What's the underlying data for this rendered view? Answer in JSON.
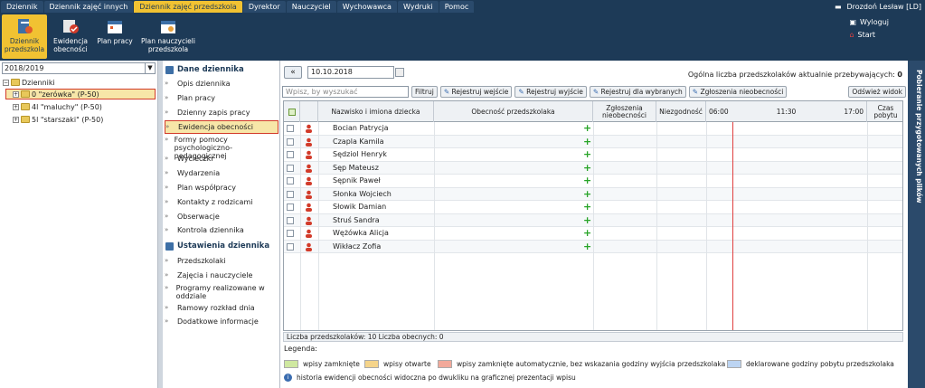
{
  "topnav": {
    "tabs": [
      "Dziennik",
      "Dziennik zajęć innych",
      "Dziennik zajęć przedszkola",
      "Dyrektor",
      "Nauczyciel",
      "Wychowawca",
      "Wydruki",
      "Pomoc"
    ],
    "active_tab": "Dziennik zajęć przedszkola",
    "user": "Drozdoń Lesław [LD]"
  },
  "toolbar": {
    "buttons": [
      {
        "label": "Dziennik przedszkola",
        "icon": "kindergarten-journal-icon"
      },
      {
        "label": "Ewidencja obecności",
        "icon": "attendance-icon"
      },
      {
        "label": "Plan pracy",
        "icon": "calendar-icon"
      },
      {
        "label": "Plan nauczycieli przedszkola",
        "icon": "teacher-plan-icon"
      }
    ],
    "logout": "Wyloguj",
    "start": "Start"
  },
  "left": {
    "year": "2018/2019",
    "root": "Dzienniki",
    "groups": [
      "0 \"zerówka\" (P-50)",
      "4l \"maluchy\" (P-50)",
      "5l \"starszaki\" (P-50)"
    ]
  },
  "menu": {
    "section1": "Dane dziennika",
    "items1": [
      "Opis dziennika",
      "Plan pracy",
      "Dzienny zapis pracy",
      "Ewidencja obecności",
      "Formy pomocy psychologiczno-pedagogicznej",
      "Wycieczki",
      "Wydarzenia",
      "Plan współpracy",
      "Kontakty z rodzicami",
      "Obserwacje",
      "Kontrola dziennika"
    ],
    "selected": "Ewidencja obecności",
    "section2": "Ustawienia dziennika",
    "items2": [
      "Przedszkolaki",
      "Zajęcia i nauczyciele",
      "Programy realizowane w oddziale",
      "Ramowy rozkład dnia",
      "Dodatkowe informacje"
    ]
  },
  "main": {
    "date": "10.10.2018",
    "count_label": "Ogólna liczba przedszkolaków aktualnie przebywających:",
    "count_value": "0",
    "search_placeholder": "Wpisz, by wyszukać",
    "buttons": [
      "Filtruj",
      "Rejestruj wejście",
      "Rejestruj wyjście",
      "Rejestruj dla wybranych",
      "Zgłoszenia nieobecności"
    ],
    "refresh": "Odśwież widok",
    "columns": {
      "name": "Nazwisko i imiona dziecka",
      "presence": "Obecność przedszkolaka",
      "reports": "Zgłoszenia nieobecności",
      "discrepancy": "Niezgodność",
      "t1": "06:00",
      "t2": "11:30",
      "t3": "17:00",
      "stay": "Czas pobytu"
    },
    "children": [
      "Bocian Patrycja",
      "Czapla Kamila",
      "Sędziol Henryk",
      "Sęp Mateusz",
      "Sępnik Paweł",
      "Słonka Wojciech",
      "Słowik Damian",
      "Struś Sandra",
      "Wężówka Alicja",
      "Wikłacz Zofia"
    ],
    "footer": "Liczba przedszkolaków: 10 Liczba obecnych: 0"
  },
  "legend": {
    "title": "Legenda:",
    "items": [
      {
        "label": "wpisy zamknięte",
        "color": "#cfe8a0"
      },
      {
        "label": "wpisy otwarte",
        "color": "#f5d48a"
      },
      {
        "label": "wpisy zamknięte automatycznie, bez wskazania godziny wyjścia przedszkolaka",
        "color": "#f2a99a"
      },
      {
        "label": "deklarowane godziny pobytu przedszkolaka",
        "color": "#bcd4f2"
      }
    ],
    "info": "historia ewidencji obecności widoczna po dwukliku na graficznej prezentacji wpisu"
  },
  "rightpanel": {
    "label": "Pobieranie przygotowanych plików"
  }
}
